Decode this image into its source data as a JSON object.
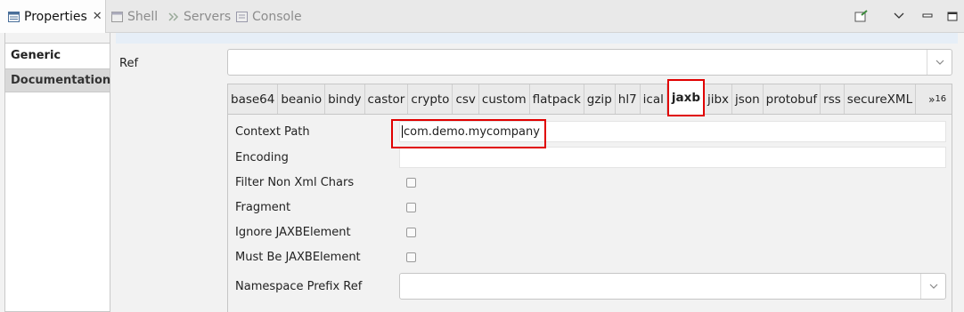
{
  "top_tabs": {
    "properties": "Properties",
    "shell": "Shell",
    "servers": "Servers",
    "console": "Console"
  },
  "side_nav": {
    "generic": "Generic",
    "documentation": "Documentation"
  },
  "ref": {
    "label": "Ref",
    "value": ""
  },
  "data_formats": {
    "tabs": [
      "base64",
      "beanio",
      "bindy",
      "castor",
      "crypto",
      "csv",
      "custom",
      "flatpack",
      "gzip",
      "hl7",
      "ical",
      "jaxb",
      "jibx",
      "json",
      "protobuf",
      "rss",
      "secureXML"
    ],
    "active": "jaxb",
    "more_glyph": "»",
    "more_count": "16"
  },
  "form": {
    "context_path_label": "Context Path",
    "context_path_value": "com.demo.mycompany",
    "encoding_label": "Encoding",
    "encoding_value": "",
    "filter_label": "Filter Non Xml Chars",
    "fragment_label": "Fragment",
    "ignore_label": "Ignore JAXBElement",
    "must_label": "Must Be JAXBElement",
    "namespace_label": "Namespace Prefix Ref"
  },
  "colors": {
    "highlight": "#e00000",
    "strip": "#e6eef7"
  }
}
